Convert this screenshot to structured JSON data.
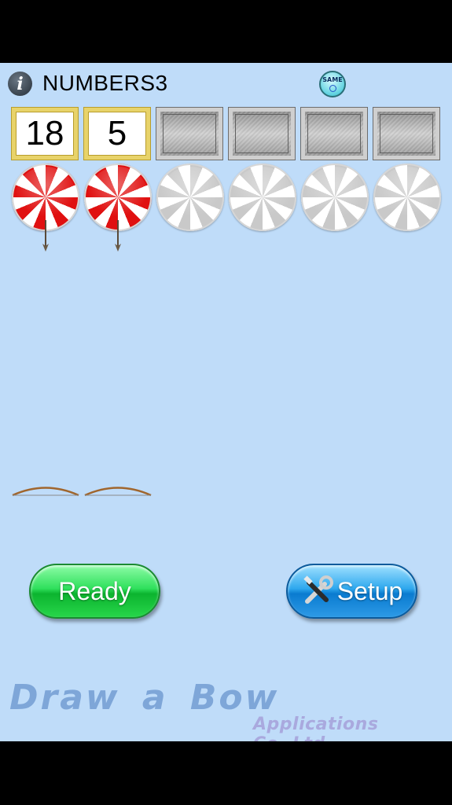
{
  "header": {
    "info_icon": "info-icon",
    "title": "NUMBERS3",
    "badge_label": "SAME",
    "badge_icon": "circle-icon"
  },
  "number_boxes": [
    {
      "value": "18",
      "state": "filled"
    },
    {
      "value": "5",
      "state": "filled"
    },
    {
      "value": "",
      "state": "empty"
    },
    {
      "value": "",
      "state": "empty"
    },
    {
      "value": "",
      "state": "empty"
    },
    {
      "value": "",
      "state": "empty"
    }
  ],
  "targets": [
    {
      "state": "hit",
      "arrow": true
    },
    {
      "state": "hit",
      "arrow": true
    },
    {
      "state": "unhit",
      "arrow": false
    },
    {
      "state": "unhit",
      "arrow": false
    },
    {
      "state": "unhit",
      "arrow": false
    },
    {
      "state": "unhit",
      "arrow": false
    }
  ],
  "bows_remaining": 2,
  "buttons": {
    "ready_label": "Ready",
    "setup_label": "Setup",
    "setup_icon": "tools-icon"
  },
  "branding": {
    "app_name": "Draw a Bow",
    "company": "Applications Co.,Ltd"
  },
  "colors": {
    "background": "#bfdcf9",
    "target_red": "#e01010",
    "ready_green": "#2fe05c",
    "setup_blue": "#2ea8ee",
    "filled_box_border": "#e8d36a"
  }
}
